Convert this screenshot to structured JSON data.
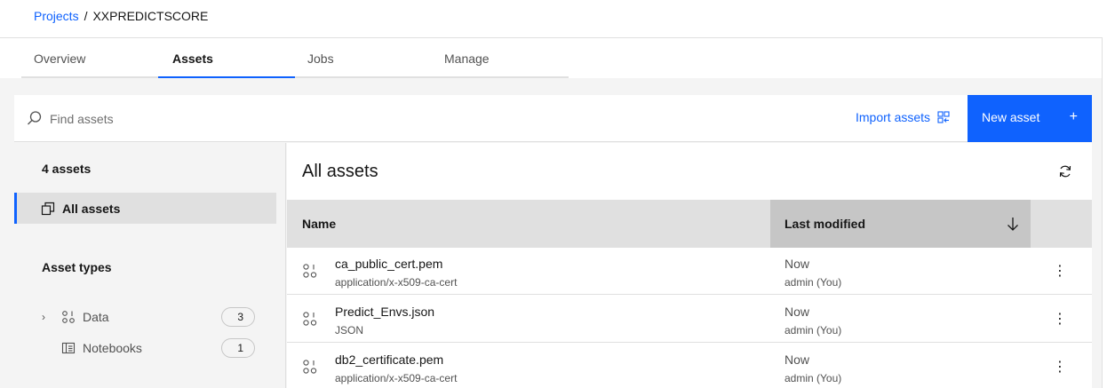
{
  "breadcrumb": {
    "projects": "Projects",
    "separator": "/",
    "current": "XXPREDICTSCORE"
  },
  "tabs": [
    {
      "label": "Overview",
      "active": false
    },
    {
      "label": "Assets",
      "active": true
    },
    {
      "label": "Jobs",
      "active": false
    },
    {
      "label": "Manage",
      "active": false
    }
  ],
  "toolbar": {
    "search_placeholder": "Find assets",
    "search_icon": "search-icon",
    "import_label": "Import assets",
    "import_icon": "import-icon",
    "new_label": "New asset",
    "new_icon": "+"
  },
  "sidebar": {
    "count": "4 assets",
    "all_assets_label": "All assets",
    "types_title": "Asset types",
    "types": [
      {
        "label": "Data",
        "count": "3",
        "icon": "data-icon",
        "chevron": "›"
      },
      {
        "label": "Notebooks",
        "count": "1",
        "icon": "notebook-icon",
        "chevron": ""
      }
    ]
  },
  "main": {
    "title": "All assets",
    "table": {
      "col_name": "Name",
      "col_modified": "Last modified",
      "rows": [
        {
          "name": "ca_public_cert.pem",
          "type": "application/x-x509-ca-cert",
          "modified": "Now",
          "user": "admin (You)"
        },
        {
          "name": "Predict_Envs.json",
          "type": "JSON",
          "modified": "Now",
          "user": "admin (You)"
        },
        {
          "name": "db2_certificate.pem",
          "type": "application/x-x509-ca-cert",
          "modified": "Now",
          "user": "admin (You)"
        }
      ]
    }
  },
  "colors": {
    "accent": "#0f62fe",
    "panel_bg": "#f4f4f4",
    "header_bg": "#e0e0e0",
    "sorted_header_bg": "#c6c6c6"
  }
}
